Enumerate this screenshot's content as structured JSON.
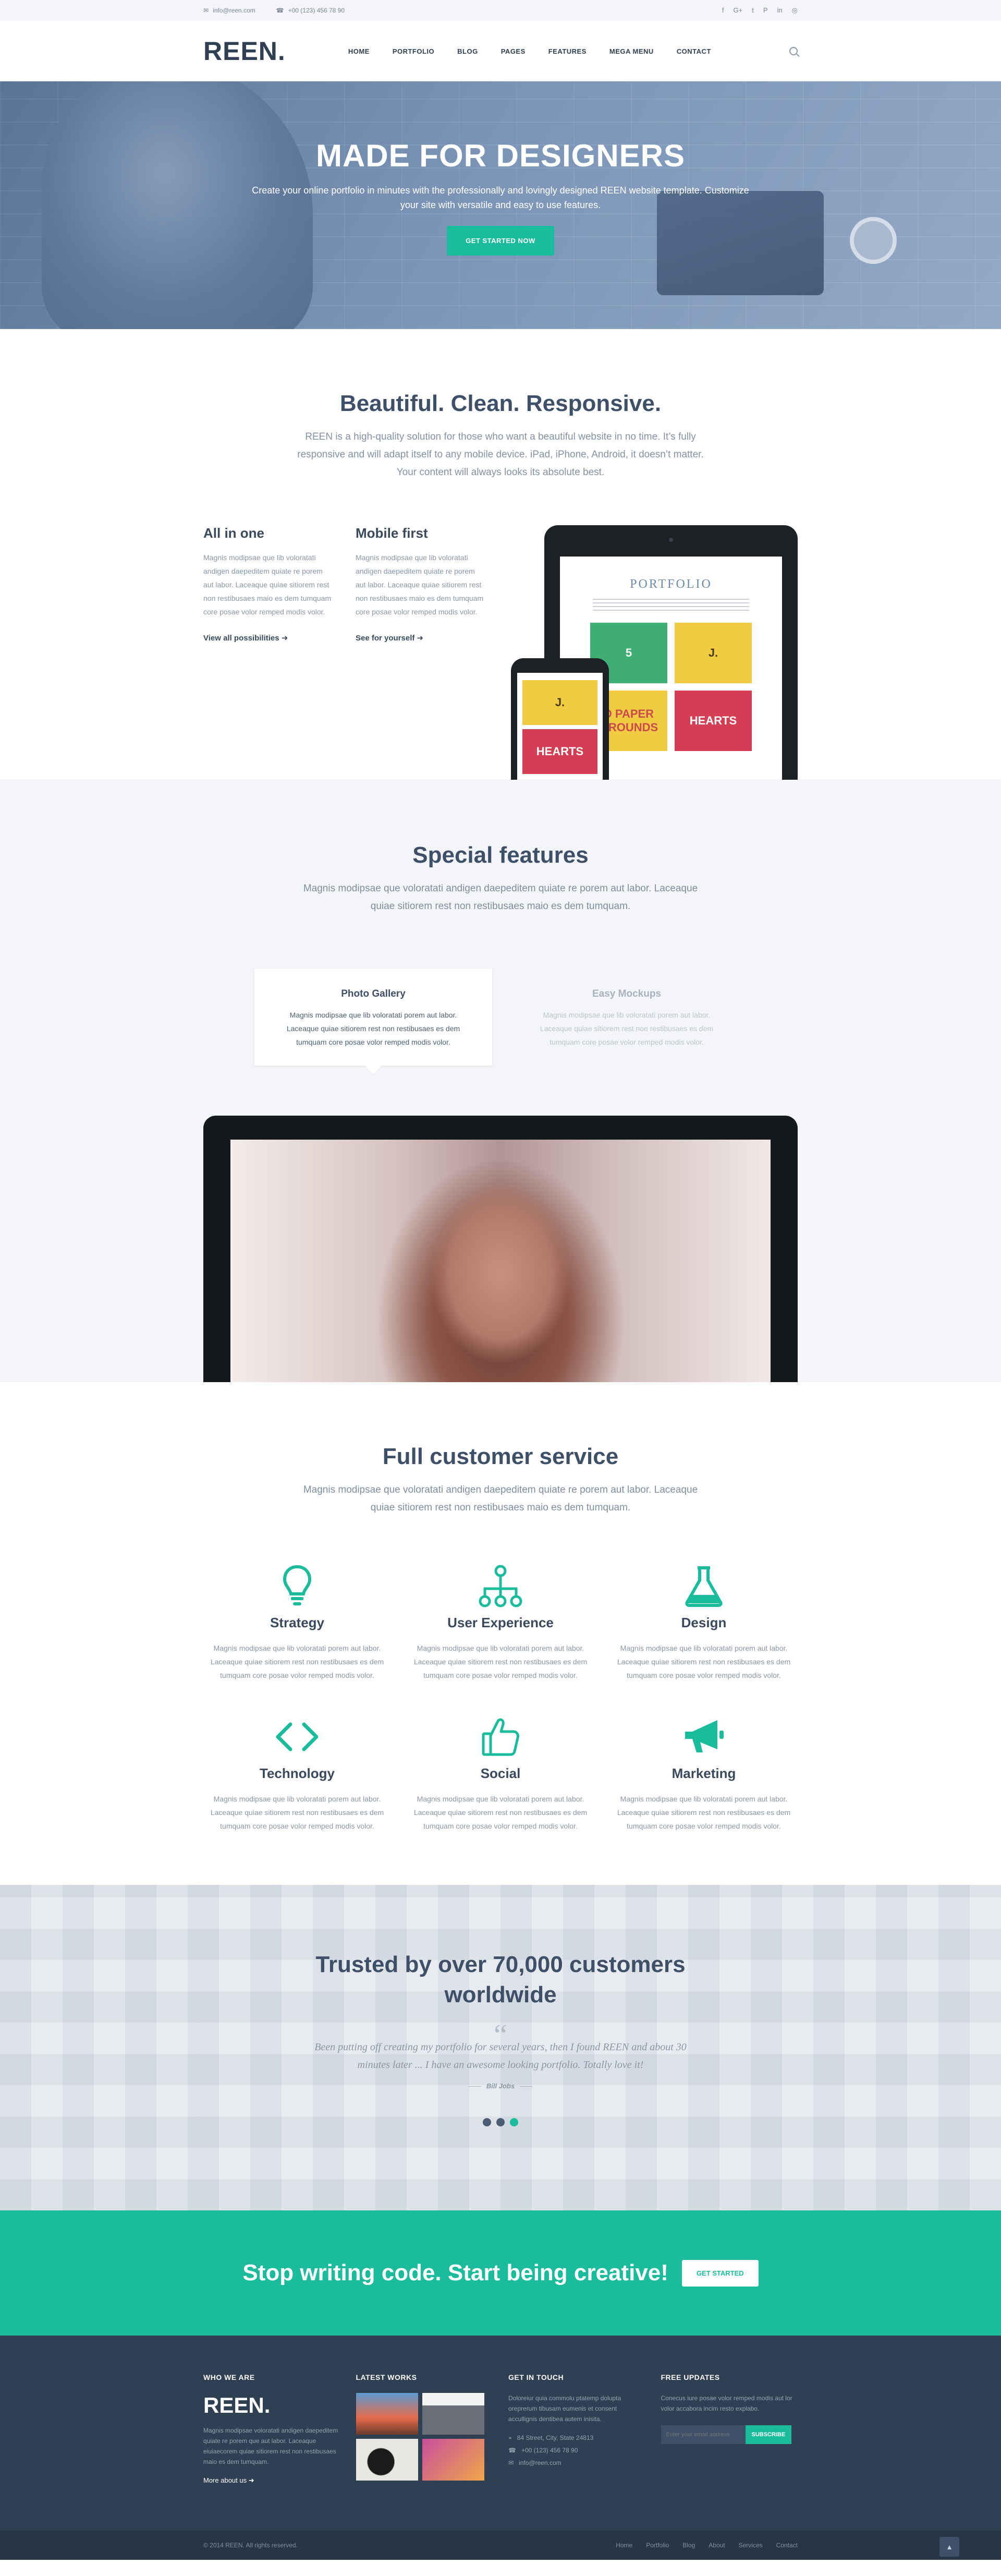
{
  "topbar": {
    "email": "info@reen.com",
    "phone": "+00 (123) 456 78 90",
    "social": [
      "f",
      "G+",
      "t",
      "P",
      "in",
      "◎"
    ]
  },
  "header": {
    "logo": "REEN.",
    "nav": [
      "HOME",
      "PORTFOLIO",
      "BLOG",
      "PAGES",
      "FEATURES",
      "MEGA MENU",
      "CONTACT"
    ]
  },
  "hero": {
    "title": "MADE FOR DESIGNERS",
    "subtitle": "Create your online portfolio in minutes with the professionally and lovingly designed REEN website template. Customize your site with versatile and easy to use features.",
    "button": "GET STARTED NOW"
  },
  "intro": {
    "title": "Beautiful. Clean. Responsive.",
    "lead": "REEN is a high-quality solution for those who want a beautiful website in no time. It’s fully responsive and will adapt itself to any mobile device. iPad, iPhone, Android, it doesn’t matter. Your content will always looks its absolute best.",
    "col1": {
      "title": "All in one",
      "text": "Magnis modipsae que lib voloratati andigen daepeditem quiate re porem aut labor. Laceaque quiae sitiorem rest non restibusaes maio es dem tumquam core posae volor remped modis volor.",
      "link": "View all possibilities"
    },
    "col2": {
      "title": "Mobile first",
      "text": "Magnis modipsae que lib voloratati andigen daepeditem quiate re porem aut labor. Laceaque quiae sitiorem rest non restibusaes maio es dem tumquam core posae volor remped modis volor.",
      "link": "See for yourself"
    },
    "device": {
      "portfolio": "PORTFOLIO",
      "tile1": "5",
      "tile2": "J.",
      "tile3": "D PAPER\nGROUNDS",
      "tile4": "HEARTS"
    }
  },
  "features": {
    "title": "Special features",
    "lead": "Magnis modipsae que voloratati andigen daepeditem quiate re porem aut labor. Laceaque quiae sitiorem rest non restibusaes maio es dem tumquam.",
    "tabs": [
      {
        "title": "Photo Gallery",
        "text": "Magnis modipsae que lib voloratati porem aut labor. Laceaque quiae sitiorem rest non restibusaes es dem tumquam core posae volor remped modis volor."
      },
      {
        "title": "Easy Mockups",
        "text": "Magnis modipsae que lib voloratati porem aut labor. Laceaque quiae sitiorem rest non restibusaes es dem tumquam core posae volor remped modis volor."
      }
    ]
  },
  "service": {
    "title": "Full customer service",
    "lead": "Magnis modipsae que voloratati andigen daepeditem quiate re porem aut labor. Laceaque quiae sitiorem rest non restibusaes maio es dem tumquam.",
    "items": [
      {
        "icon": "lightbulb-icon",
        "title": "Strategy",
        "text": "Magnis modipsae que lib voloratati porem aut labor. Laceaque quiae sitiorem rest non restibusaes es dem tumquam core posae volor remped modis volor."
      },
      {
        "icon": "sitemap-icon",
        "title": "User Experience",
        "text": "Magnis modipsae que lib voloratati porem aut labor. Laceaque quiae sitiorem rest non restibusaes es dem tumquam core posae volor remped modis volor."
      },
      {
        "icon": "flask-icon",
        "title": "Design",
        "text": "Magnis modipsae que lib voloratati porem aut labor. Laceaque quiae sitiorem rest non restibusaes es dem tumquam core posae volor remped modis volor."
      },
      {
        "icon": "code-icon",
        "title": "Technology",
        "text": "Magnis modipsae que lib voloratati porem aut labor. Laceaque quiae sitiorem rest non restibusaes es dem tumquam core posae volor remped modis volor."
      },
      {
        "icon": "thumbs-up-icon",
        "title": "Social",
        "text": "Magnis modipsae que lib voloratati porem aut labor. Laceaque quiae sitiorem rest non restibusaes es dem tumquam core posae volor remped modis volor."
      },
      {
        "icon": "megaphone-icon",
        "title": "Marketing",
        "text": "Magnis modipsae que lib voloratati porem aut labor. Laceaque quiae sitiorem rest non restibusaes es dem tumquam core posae volor remped modis volor."
      }
    ]
  },
  "testimonial": {
    "title": "Trusted by over 70,000 customers worldwide",
    "quote_mark": "“",
    "quote": "Been putting off creating my portfolio for several years, then I found REEN and about 30 minutes later ... I have an awesome looking portfolio. Totally love it!",
    "author": "Bill Jobs"
  },
  "cta": {
    "title": "Stop writing code. Start being creative!",
    "button": "GET STARTED"
  },
  "footer": {
    "who": {
      "heading": "WHO WE ARE",
      "logo": "REEN.",
      "text": "Magnis modipsae voloratati andigen daepeditem quiate re porem que aut labor. Laceaque eiuiaecorem quiae sitiorem rest non restibusaes maio es dem tumquam.",
      "link": "More about us"
    },
    "works": {
      "heading": "LATEST WORKS"
    },
    "contact": {
      "heading": "GET IN TOUCH",
      "text": "Doloreiur quia commolu ptatemp dolupta oreprerum tibusam eumenis et consent accullignis dentibea autem inisita.",
      "address": "84 Street, City, State 24813",
      "phone": "+00 (123) 456 78 90",
      "email": "info@reen.com"
    },
    "updates": {
      "heading": "FREE UPDATES",
      "text": "Conecus iure posae volor remped modis aut lor volor accabora incim resto explabo.",
      "placeholder": "Enter your email address",
      "button": "SUBSCRIBE"
    },
    "copyright": "© 2014 REEN. All rights reserved.",
    "links": [
      "Home",
      "Portfolio",
      "Blog",
      "About",
      "Services",
      "Contact"
    ]
  },
  "colors": {
    "accent": "#1abc9c",
    "dark": "#2f4052",
    "heading": "#3e5068",
    "muted": "#8a97a6"
  }
}
